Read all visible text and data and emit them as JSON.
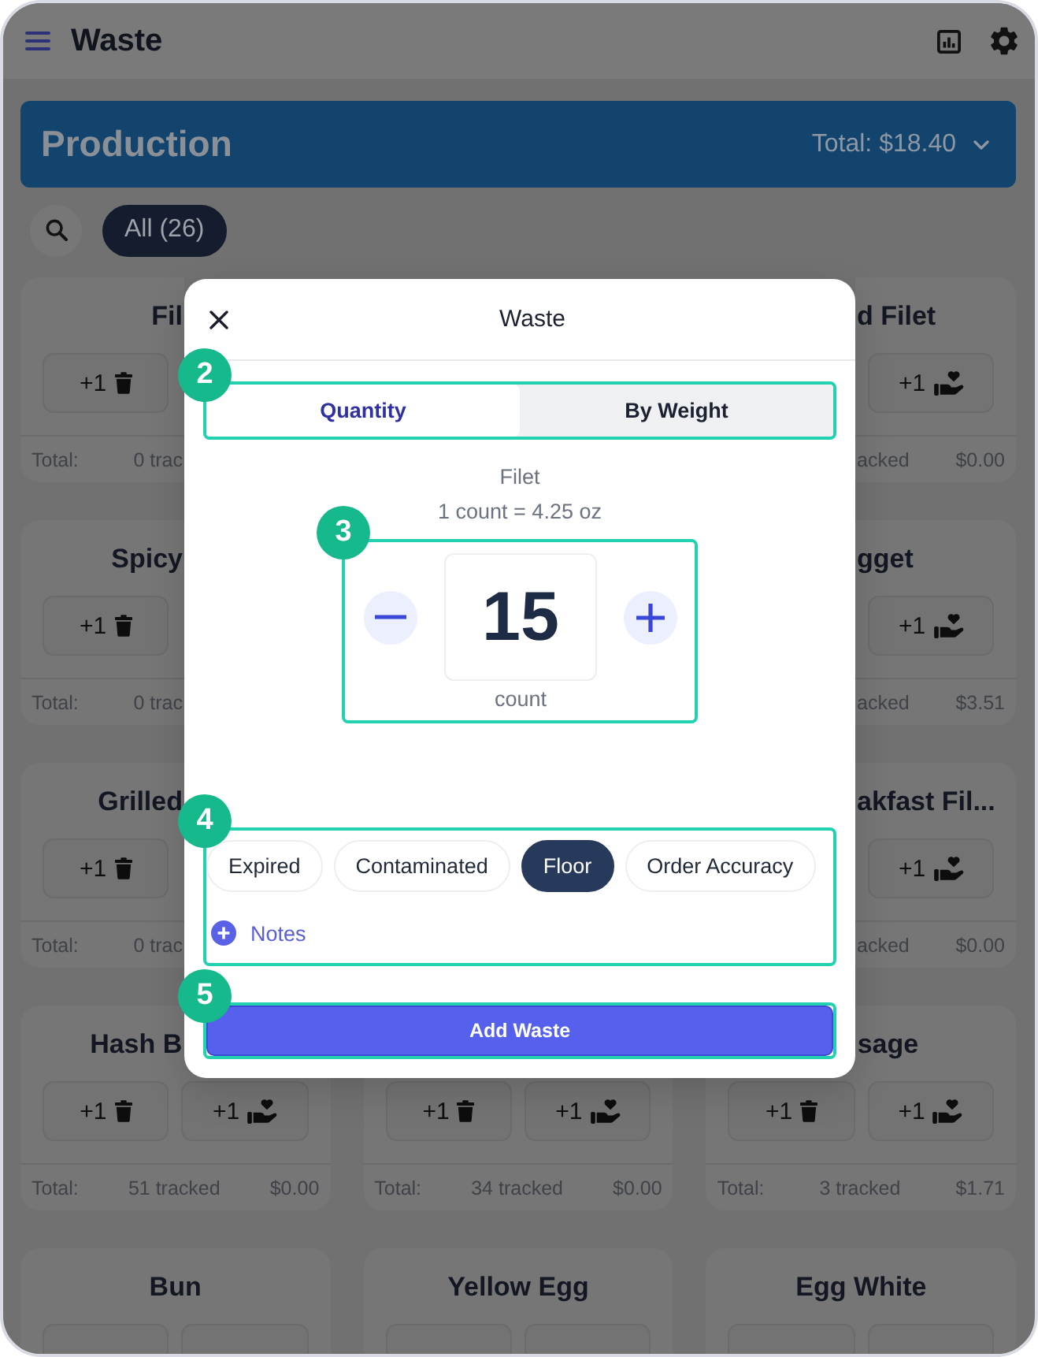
{
  "app_bar": {
    "title": "Waste"
  },
  "banner": {
    "title": "Production",
    "total": "Total: $18.40"
  },
  "filters": {
    "chips": [
      {
        "label": "All (26)",
        "selected": true
      }
    ]
  },
  "card_rows": [
    {
      "left": {
        "title": "Fil",
        "buttons": [
          {
            "kind": "trash",
            "label": "+1"
          }
        ],
        "footer": {
          "label": "Total:",
          "tracked": "0 trac"
        }
      },
      "right": {
        "title": "d Filet",
        "buttons": [
          {
            "kind": "donate",
            "label": "+1"
          }
        ],
        "footer": {
          "tracked": "acked",
          "cost": "$0.00"
        }
      }
    },
    {
      "left": {
        "title": "Spicy",
        "buttons": [
          {
            "kind": "trash",
            "label": "+1"
          }
        ],
        "footer": {
          "label": "Total:",
          "tracked": "0 trac"
        }
      },
      "right": {
        "title": "gget",
        "buttons": [
          {
            "kind": "donate",
            "label": "+1"
          }
        ],
        "footer": {
          "tracked": "acked",
          "cost": "$3.51"
        }
      }
    },
    {
      "left": {
        "title": "Grilled",
        "buttons": [
          {
            "kind": "trash",
            "label": "+1"
          }
        ],
        "footer": {
          "label": "Total:",
          "tracked": "0 trac"
        }
      },
      "right": {
        "title": "akfast Fil...",
        "buttons": [
          {
            "kind": "donate",
            "label": "+1"
          }
        ],
        "footer": {
          "tracked": "acked",
          "cost": "$0.00"
        }
      }
    },
    {
      "left": {
        "title": "Hash B",
        "buttons": [
          {
            "kind": "trash",
            "label": "+1"
          },
          {
            "kind": "donate",
            "label": "+1"
          }
        ],
        "footer": {
          "label": "Total:",
          "tracked": "51 tracked",
          "cost": "$0.00"
        }
      },
      "middle": {
        "buttons": [
          {
            "kind": "trash",
            "label": "+1"
          },
          {
            "kind": "donate",
            "label": "+1"
          }
        ],
        "footer": {
          "label": "Total:",
          "tracked": "34 tracked",
          "cost": "$0.00"
        }
      },
      "right": {
        "title": "sage",
        "buttons": [
          {
            "kind": "trash",
            "label": "+1"
          },
          {
            "kind": "donate",
            "label": "+1"
          }
        ],
        "footer": {
          "label": "Total:",
          "tracked": "3 tracked",
          "cost": "$1.71"
        }
      }
    },
    {
      "left": {
        "title": "Bun",
        "buttons_cut_off": true
      },
      "middle": {
        "title": "Yellow Egg",
        "buttons_cut_off": true
      },
      "right": {
        "title": "Egg White",
        "buttons_cut_off": true
      }
    }
  ],
  "dialog": {
    "title": "Waste",
    "mode_tabs": {
      "callout": "2",
      "tabs": [
        {
          "label": "Quantity",
          "selected": true
        },
        {
          "label": "By Weight",
          "selected": false
        }
      ]
    },
    "item_name": "Filet",
    "conversion": "1 count = 4.25 oz",
    "stepper": {
      "callout": "3",
      "value": "15",
      "unit": "count"
    },
    "reasons": {
      "callout": "4",
      "chips": [
        {
          "label": "Expired",
          "selected": false
        },
        {
          "label": "Contaminated",
          "selected": false
        },
        {
          "label": "Floor",
          "selected": true
        },
        {
          "label": "Order Accuracy",
          "selected": false
        }
      ],
      "notes_link": "Notes"
    },
    "submit": {
      "callout": "5",
      "label": "Add Waste"
    }
  }
}
